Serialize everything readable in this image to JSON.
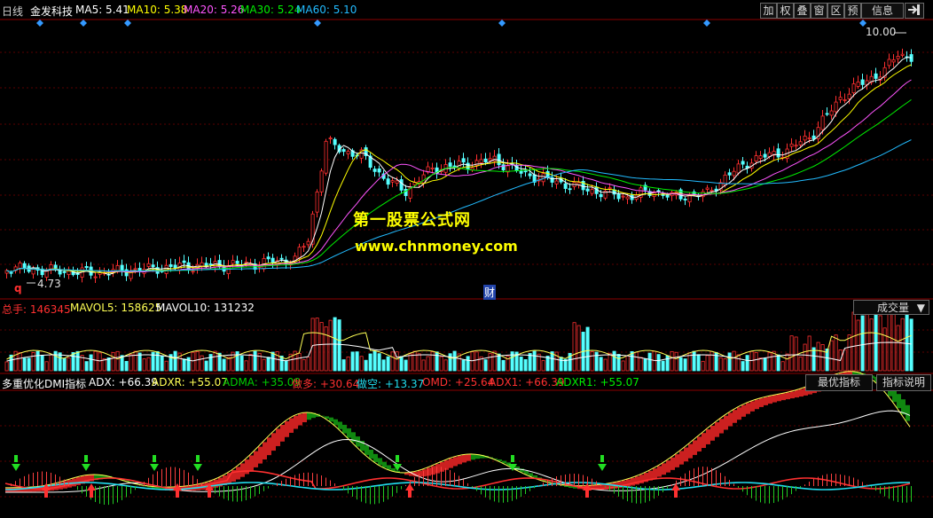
{
  "header": {
    "period": "日线",
    "stock_name": "金发科技",
    "ma": [
      {
        "label": "MA5: 5.41",
        "color": "#ffffff"
      },
      {
        "label": "MA10: 5.38",
        "color": "#ffff00"
      },
      {
        "label": "MA20: 5.26",
        "color": "#ff55ff"
      },
      {
        "label": "MA30: 5.24",
        "color": "#00ee00"
      },
      {
        "label": "MA60: 5.10",
        "color": "#22bbff"
      }
    ]
  },
  "toolbar": [
    "加",
    "权",
    "叠",
    "窗",
    "区",
    "预",
    "信息"
  ],
  "toolbar_icon": "exit-right-icon",
  "price": {
    "high_label": "10.00",
    "low_label": "4.73",
    "q_marker": "q",
    "cai_marker": "财",
    "axis_min": 4.3,
    "axis_max": 10.6
  },
  "volume": {
    "head": [
      {
        "text": "总手: 146345",
        "color": "#ff3030"
      },
      {
        "text": "MAVOL5: 158625",
        "color": "#ffff55"
      },
      {
        "text": "MAVOL10: 131232",
        "color": "#ffffff"
      }
    ],
    "button": "成交量"
  },
  "indicator": {
    "head": [
      {
        "text": "多重优化DMI指标",
        "color": "#ffffff"
      },
      {
        "text": "ADX: +66.39",
        "color": "#ffffff"
      },
      {
        "text": "ADXR: +55.07",
        "color": "#ffff55"
      },
      {
        "text": "ADMA: +35.09",
        "color": "#00cc00"
      },
      {
        "text": "做多: +30.64",
        "color": "#ff3030"
      },
      {
        "text": "做空: +13.37",
        "color": "#22ddee"
      },
      {
        "text": "OMD: +25.64",
        "color": "#ff3030"
      },
      {
        "text": "ADX1: +66.39",
        "color": "#ff3030"
      },
      {
        "text": "ADXR1: +55.07",
        "color": "#00ee00"
      }
    ],
    "buttons": [
      "最优指标",
      "指标说明"
    ]
  },
  "watermark": {
    "line1": "第一股票公式网",
    "line2": "www.chnmoney.com"
  },
  "colors": {
    "up": "#ff3030",
    "down": "#55ffff",
    "grid": "#8b0000",
    "ma5": "#ffffff",
    "ma10": "#ffff00",
    "ma20": "#ff55ff",
    "ma30": "#00ee00",
    "ma60": "#22bbff",
    "diamond": "#3399ff"
  },
  "icons": [
    "diamond-marker-icon",
    "buy-arrow-icon",
    "sell-arrow-icon"
  ]
}
